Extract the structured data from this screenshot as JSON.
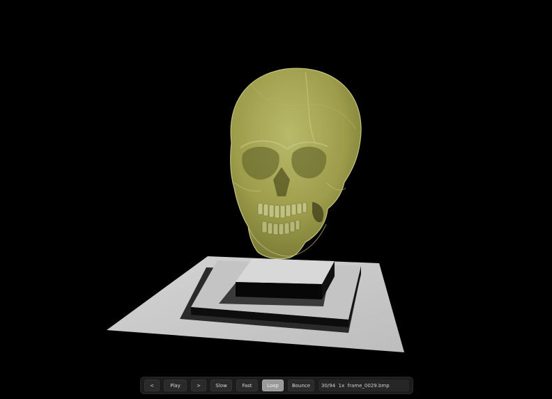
{
  "controls": {
    "prev_label": "<",
    "play_label": "Play",
    "next_label": ">",
    "slow_label": "Slow",
    "fast_label": "Fast",
    "loop_label": "Loop",
    "bounce_label": "Bounce",
    "status_text": "30/94  1x  frame_0029.bmp"
  },
  "colors": {
    "background": "#000000",
    "skull_fill": "#b8b85a",
    "pedestal_top": "#d8d8d8",
    "loop_active": "#9a9a9a"
  },
  "icons": {
    "prev": "chevron-left-icon",
    "next": "chevron-right-icon"
  }
}
